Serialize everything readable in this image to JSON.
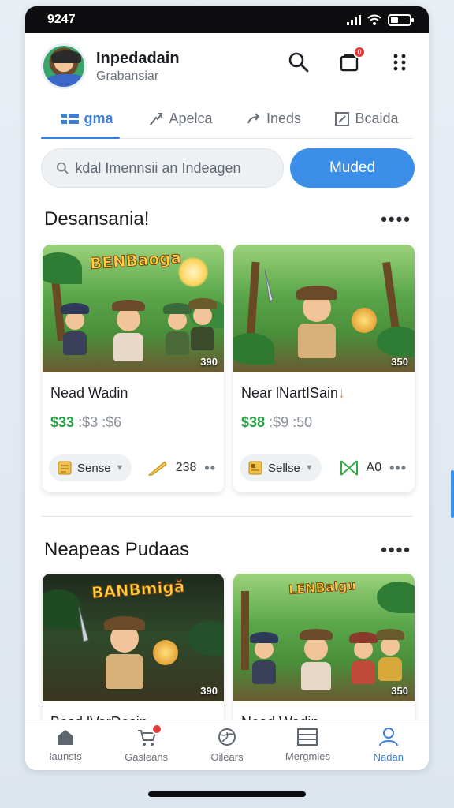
{
  "status": {
    "time": "9247"
  },
  "header": {
    "user_name": "Inpedadain",
    "user_sub": "Grabansiar",
    "notification_count": "0"
  },
  "tabs": [
    {
      "label": "gma",
      "icon": "grid-icon",
      "active": true
    },
    {
      "label": "Apelca",
      "icon": "share-arrow-icon",
      "active": false
    },
    {
      "label": "Ineds",
      "icon": "reply-arrow-icon",
      "active": false
    },
    {
      "label": "Bcaida",
      "icon": "edit-square-icon",
      "active": false
    }
  ],
  "search": {
    "placeholder": "kdal Imennsii an Indeagen",
    "button_label": "Muded"
  },
  "section1": {
    "title": "Desansania!",
    "more": "••••",
    "cards": [
      {
        "logo": "BENBaoga",
        "price_tag": "390",
        "title": "Nead Wadin",
        "price_main": "$33",
        "price_alt": ":$3 :$6",
        "pill_label": "Sense",
        "stat_value": "238",
        "stat_icon": "feather-icon",
        "more": "••"
      },
      {
        "logo": "",
        "price_tag": "350",
        "title": "Near lNartISain",
        "price_main": "$38",
        "price_alt": ":$9 :50",
        "pill_label": "Sellse",
        "stat_value": "A0",
        "stat_icon": "bow-icon",
        "more": "•••"
      }
    ]
  },
  "section2": {
    "title": "Neapeas Pudaas",
    "more": "••••",
    "cards": [
      {
        "logo": "BANBmigă",
        "price_tag": "390",
        "title": "Besd lVarDesin"
      },
      {
        "logo": "LENBalgu",
        "price_tag": "350",
        "title": "Nead Wadin"
      }
    ]
  },
  "nav": [
    {
      "label": "launsts",
      "icon": "home-icon",
      "active": false
    },
    {
      "label": "Gasleans",
      "icon": "cart-icon",
      "active": false
    },
    {
      "label": "Oilears",
      "icon": "globe-icon",
      "active": false
    },
    {
      "label": "Mergmies",
      "icon": "list-icon",
      "active": false
    },
    {
      "label": "Nadan",
      "icon": "person-icon",
      "active": true
    }
  ],
  "colors": {
    "accent": "#3c7fd6",
    "cta": "#3c8fe8",
    "price_green": "#27a243",
    "badge_red": "#e23b3b"
  }
}
